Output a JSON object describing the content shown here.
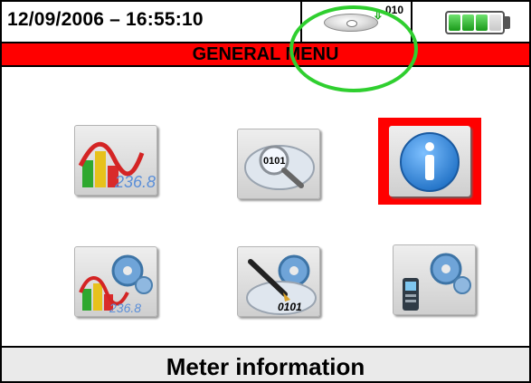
{
  "header": {
    "datetime": "12/09/2006 – 16:55:10",
    "transfer_indicator": {
      "icon": "disc-download-icon",
      "text": "010"
    },
    "battery": {
      "icon": "battery-icon",
      "level_cells": 3,
      "total_cells": 4
    }
  },
  "menu": {
    "title": "GENERAL MENU",
    "items": [
      {
        "name": "measurements",
        "icon": "chart-measurement-icon",
        "selected": false
      },
      {
        "name": "recordings",
        "icon": "data-search-icon",
        "selected": false
      },
      {
        "name": "meter-information",
        "icon": "info-icon",
        "selected": true
      },
      {
        "name": "analyzer-settings",
        "icon": "chart-gear-icon",
        "selected": false
      },
      {
        "name": "recording-settings",
        "icon": "pen-gear-icon",
        "selected": false
      },
      {
        "name": "general-settings",
        "icon": "meter-gear-icon",
        "selected": false
      }
    ]
  },
  "footer": {
    "selected_label": "Meter information"
  },
  "colors": {
    "title_bar": "#ff0000",
    "selection_frame": "#ff0000",
    "highlight_ring": "#2fcf2f",
    "battery_fill": "#1a9a1a",
    "info_blue": "#1e6fc4"
  }
}
